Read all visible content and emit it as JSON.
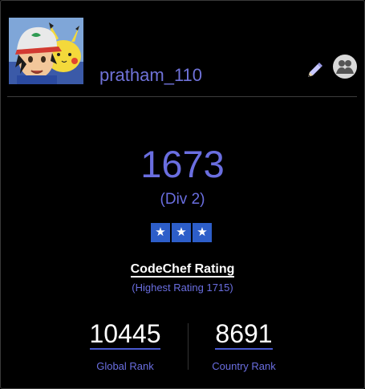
{
  "profile": {
    "username": "pratham_110"
  },
  "rating": {
    "value": "1673",
    "division": "(Div 2)",
    "stars": [
      "★",
      "★",
      "★"
    ],
    "label": "CodeChef Rating",
    "highest": "(Highest Rating 1715)"
  },
  "ranks": {
    "global": {
      "value": "10445",
      "label": "Global Rank"
    },
    "country": {
      "value": "8691",
      "label": "Country Rank"
    }
  },
  "colors": {
    "accent": "#6a6ee0",
    "star_bg": "#2d5ec9",
    "background": "#000000"
  },
  "icons": {
    "edit": "pencil-icon",
    "friends": "friends-icon"
  }
}
